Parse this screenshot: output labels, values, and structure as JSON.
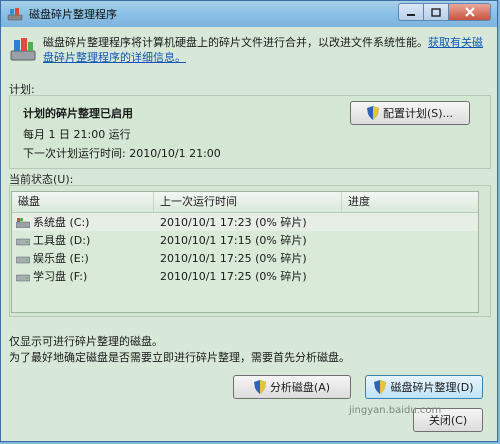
{
  "window": {
    "title": "磁盘碎片整理程序"
  },
  "intro": {
    "text": "磁盘碎片整理程序将计算机硬盘上的碎片文件进行合并，以改进文件系统性能。",
    "link": "获取有关磁盘碎片整理程序的详细信息。"
  },
  "schedule": {
    "label": "计划:",
    "status": "计划的碎片整理已启用",
    "frequency": "每月 1 日 21:00 运行",
    "next_run": "下一次计划运行时间: 2010/10/1 21:00",
    "configure_button": "配置计划(S)..."
  },
  "current_status": {
    "label": "当前状态(U):",
    "columns": [
      "磁盘",
      "上一次运行时间",
      "进度"
    ],
    "disks": [
      {
        "name": "系统盘 (C:)",
        "last_run": "2010/10/1 17:23 (0% 碎片)",
        "progress": ""
      },
      {
        "name": "工具盘 (D:)",
        "last_run": "2010/10/1 17:15 (0% 碎片)",
        "progress": ""
      },
      {
        "name": "娱乐盘 (E:)",
        "last_run": "2010/10/1 17:25 (0% 碎片)",
        "progress": ""
      },
      {
        "name": "学习盘 (F:)",
        "last_run": "2010/10/1 17:25 (0% 碎片)",
        "progress": ""
      }
    ]
  },
  "notes": {
    "line1": "仅显示可进行碎片整理的磁盘。",
    "line2": "为了最好地确定磁盘是否需要立即进行碎片整理，需要首先分析磁盘。"
  },
  "buttons": {
    "analyze": "分析磁盘(A)",
    "defrag": "磁盘碎片整理(D)",
    "close": "关闭(C)"
  },
  "watermark": "jingyan.baidu.com"
}
